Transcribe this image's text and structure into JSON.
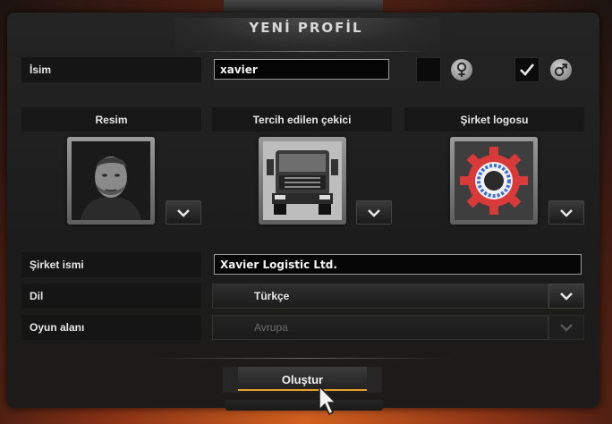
{
  "dialog": {
    "title": "YENİ PROFİL"
  },
  "name_row": {
    "label": "İsim",
    "value": "xavier",
    "female_selected": false,
    "male_selected": true
  },
  "columns": {
    "portrait": {
      "heading": "Resim"
    },
    "truck": {
      "heading": "Tercih edilen çekici"
    },
    "logo": {
      "heading": "Şirket logosu"
    }
  },
  "company_row": {
    "label": "Şirket ismi",
    "value": "Xavier Logistic Ltd."
  },
  "language_row": {
    "label": "Dil",
    "value": "Türkçe"
  },
  "game_area_row": {
    "label": "Oyun alanı",
    "value": "Avrupa",
    "enabled": false
  },
  "actions": {
    "create_label": "Oluştur"
  },
  "icons": {
    "female": "female-symbol-icon",
    "male": "male-symbol-icon",
    "dropdown": "chevron-down-icon",
    "check": "check-icon",
    "cursor": "mouse-cursor-icon"
  },
  "colors": {
    "accent": "#e8a02a",
    "logo_red": "#d83a3a",
    "logo_blue": "#3d6fd8"
  }
}
